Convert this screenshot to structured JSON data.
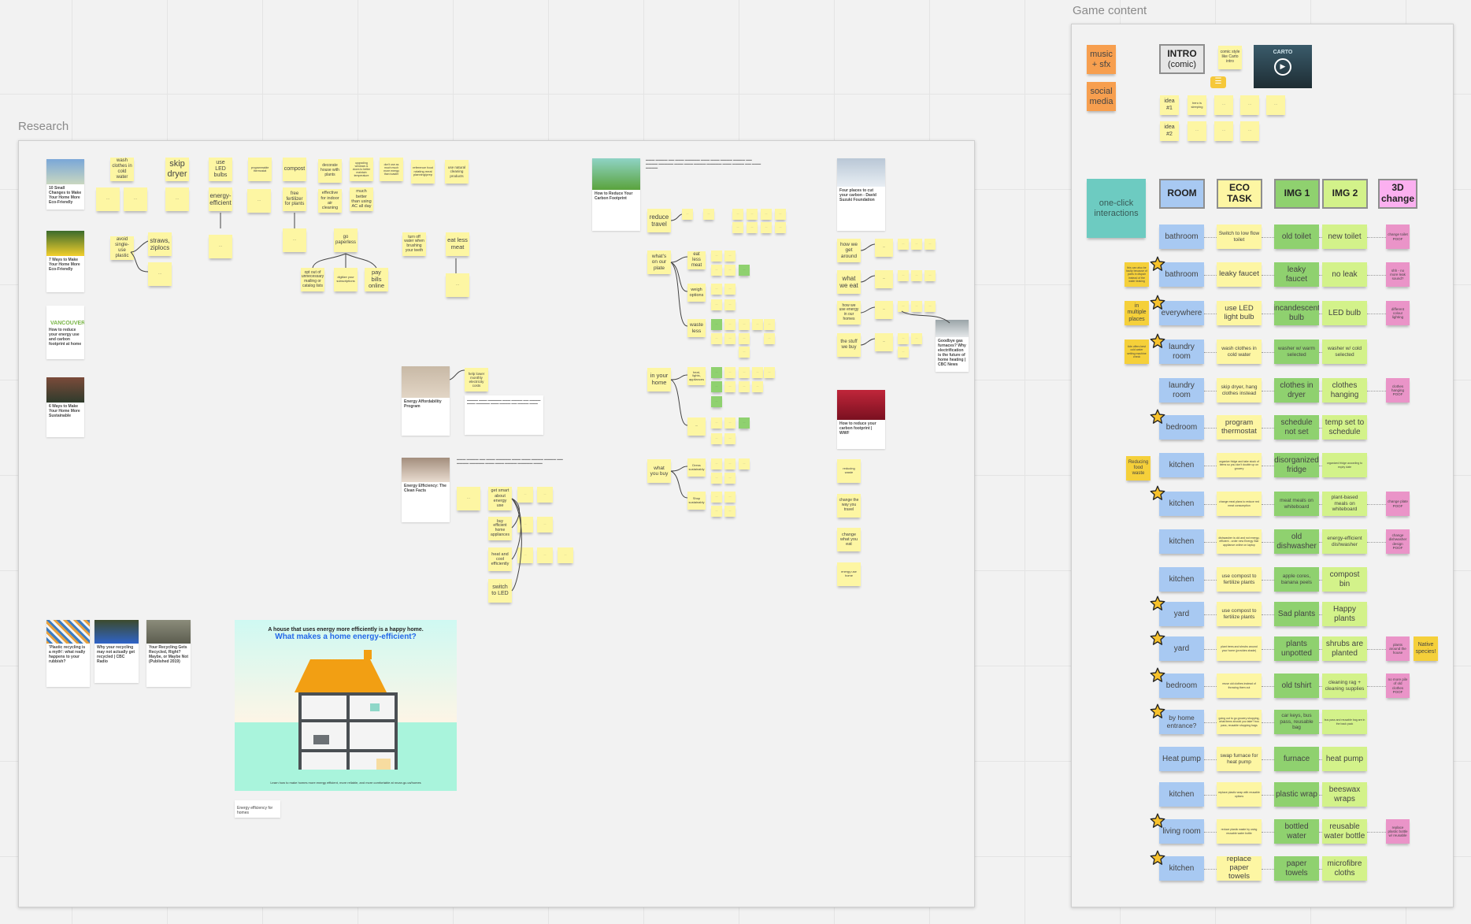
{
  "frames": {
    "research_title": "Research",
    "game_title": "Game content"
  },
  "game": {
    "music": "music + sfx",
    "social": "social media",
    "intro_line1": "INTRO",
    "intro_line2": "(comic)",
    "comic_note": "comic style like Carto intro",
    "idea1": "idea #1",
    "idea1_step1": "hero is sleeping",
    "idea2": "idea #2",
    "video_title": "CARTO",
    "one_click": "one-click interactions",
    "headers": {
      "room": "ROOM",
      "eco_task": "ECO TASK",
      "img1": "IMG 1",
      "img2": "IMG 2",
      "change3d": "3D change"
    },
    "side_notes": [
      {
        "text": "this can also be faulty because of parts in dispair instead of the water leaking",
        "row": 1
      },
      {
        "text": "in multiple places",
        "row": 2
      },
      {
        "text": "tide offers best cold water setting machine check",
        "row": 3
      },
      {
        "text": "Reducing food waste",
        "row": 6
      }
    ],
    "native_note": "Native species!",
    "rows": [
      {
        "room": "bathroom",
        "star": false,
        "task": "Switch to low flow toilet",
        "img1": "old toilet",
        "img2": "new toilet",
        "change": "change toilet POOF"
      },
      {
        "room": "bathroom",
        "star": true,
        "task": "leaky faucet",
        "img1": "leaky faucet",
        "img2": "no leak",
        "change": "shh - no more leak sound?"
      },
      {
        "room": "everywhere",
        "star": true,
        "task": "use LED light bulb",
        "img1": "incandescent bulb",
        "img2": "LED bulb",
        "change": "different colour lighting"
      },
      {
        "room": "laundry room",
        "star": true,
        "task": "wash clothes in cold water",
        "img1": "washer w/ warm selected",
        "img2": "washer w/ cold selected",
        "change": ""
      },
      {
        "room": "laundry room",
        "star": false,
        "task": "skip dryer, hang clothes instead",
        "img1": "clothes in dryer",
        "img2": "clothes hanging",
        "change": "clothes hanging POOF"
      },
      {
        "room": "bedroom",
        "star": true,
        "task": "program thermostat",
        "img1": "schedule not set",
        "img2": "temp set to schedule",
        "change": ""
      },
      {
        "room": "kitchen",
        "star": false,
        "task": "organize fridge and take stock of items so you don't double up on grocery",
        "img1": "disorganized fridge",
        "img2": "organized fridge according to expiry date",
        "change": ""
      },
      {
        "room": "kitchen",
        "star": true,
        "task": "change meal plans to reduce red meat consumption",
        "img1": "meat meals on whiteboard",
        "img2": "plant-based meals on whiteboard",
        "change": "change plate POOF"
      },
      {
        "room": "kitchen",
        "star": false,
        "task": "dishwasher is old and not energy-efficient - order new Energy Star appliance online on laptop",
        "img1": "old dishwasher",
        "img2": "energy-efficient dishwasher",
        "change": "change dishwasher design POOF"
      },
      {
        "room": "kitchen",
        "star": false,
        "task": "use compost to fertilize plants",
        "img1": "apple cores, banana peels",
        "img2": "compost bin",
        "change": ""
      },
      {
        "room": "yard",
        "star": true,
        "task": "use compost to fertilize plants",
        "img1": "Sad plants",
        "img2": "Happy plants",
        "change": ""
      },
      {
        "room": "yard",
        "star": true,
        "task": "plant trees and shrubs around your home (provides shade)",
        "img1": "plants unpotted",
        "img2": "shrubs are planted",
        "change": "plants around the house"
      },
      {
        "room": "bedroom",
        "star": true,
        "task": "reuse old clothes instead of throwing them out",
        "img1": "old tshirt",
        "img2": "cleaning rag + cleaning supplies",
        "change": "no more pile of old clothes POOF"
      },
      {
        "room": "by home entrance?",
        "star": true,
        "task": "going out to go grocery shopping, what items should you take? bus pass, reusable shopping bags",
        "img1": "car keys, bus pass, reusable bag",
        "img2": "bus pass and reusable bag are in the back pack",
        "change": ""
      },
      {
        "room": "Heat pump",
        "star": false,
        "task": "swap furnace for heat pump",
        "img1": "furnace",
        "img2": "heat pump",
        "change": ""
      },
      {
        "room": "kitchen",
        "star": false,
        "task": "replace plastic wrap with reusable options",
        "img1": "plastic wrap",
        "img2": "beeswax wraps",
        "change": ""
      },
      {
        "room": "living room",
        "star": true,
        "task": "reduce plastic waste by using reusable water bottle",
        "img1": "bottled water",
        "img2": "reusable water bottle",
        "change": "replace plastic bottle w/ reusable"
      },
      {
        "room": "kitchen",
        "star": true,
        "task": "replace paper towels",
        "img1": "paper towels",
        "img2": "microfibre cloths",
        "change": ""
      }
    ]
  },
  "research": {
    "stickies_top": [
      "wash clothes in cold water",
      "skip dryer",
      "use LED bulbs",
      "programmable thermostat",
      "compost",
      "decorate house with plants",
      "upgrading windows & doors to better maintain temperature",
      "don't use as much much more energy than toaster",
      "reference food rotating meal planning/prep",
      "use natural cleaning products"
    ],
    "stickies_second": [
      "energy-efficient",
      "free fertilizer for plants",
      "effective for indoor air cleaning",
      "much better than using AC all day"
    ],
    "stickies_mid": [
      "avoid single-use plastic",
      "straws, ziplocs",
      "go paperless",
      "turn off water when brushing your teeth",
      "eat less meat",
      "opt out of unnecessary mailing or catalog lists",
      "digitize your subscriptions",
      "pay bills online"
    ],
    "carbon": {
      "reduce_travel": "reduce travel",
      "whats_on_plate": "what's on our plate",
      "eat_less_meat": "eat less meat",
      "weigh_options": "weigh options",
      "waste_less": "waste less",
      "in_your_home": "in your home",
      "heat_lights": "heat, lights, appliances",
      "what_you_buy": "what you buy",
      "dress_sustainably": "Dress sustainably",
      "shop_sustainably": "Shop sustainably"
    },
    "suzuki": {
      "how_we_get_around": "how we get around",
      "what_we_eat": "what we eat",
      "how_we_use_energy": "how we use energy in our homes",
      "stuff_we_buy": "the stuff we buy",
      "reduce_waste": "reducing waste",
      "change_travel": "change the way you travel",
      "change_eat": "change what you eat",
      "energy_home": "energy use home",
      "card_title": "Four places to cut your carbon - David Suzuki Foundation"
    },
    "energy": {
      "help_lower": "help lower monthly electricity costs",
      "get_smart": "get smart about energy use",
      "buy_efficient": "buy efficient home appliances",
      "heat_cool": "heat and cool efficiently",
      "switch_led": "switch to LED",
      "card1_title": "Energy Affordability Program",
      "card2_title": "Energy Efficiency: The Clean Facts",
      "card3_title": "How to Reduce Your Carbon Footprint"
    },
    "link_cards": [
      "10 Small Changes to Make Your Home More Eco-Friendly",
      "7 Ways to Make Your Home More Eco-Friendly",
      "How to reduce your energy use and carbon footprint at home",
      "6 Ways to Make Your Home More Sustainable",
      "'Plastic recycling is a myth': what really happens to your rubbish?",
      "Why your recycling may not actually get recycled | CBC Radio",
      "Your Recycling Gets Recycled, Right? Maybe, or Maybe Not (Published 2019)",
      "How to reduce your carbon footprint | WWF",
      "Goodbye gas furnaces? Why electrification is the future of home heating | CBC News"
    ],
    "vancouver_logo": "VANCOUVER",
    "infographic": {
      "subtitle": "A house that uses energy more efficiently is a happy home.",
      "title": "What makes a home energy-efficient?",
      "footer": "Learn how to make homes more energy efficient, more reliable, and more comfortable at nrcan.gc.ca/homes",
      "caption": "Energy efficiency for homes"
    }
  }
}
